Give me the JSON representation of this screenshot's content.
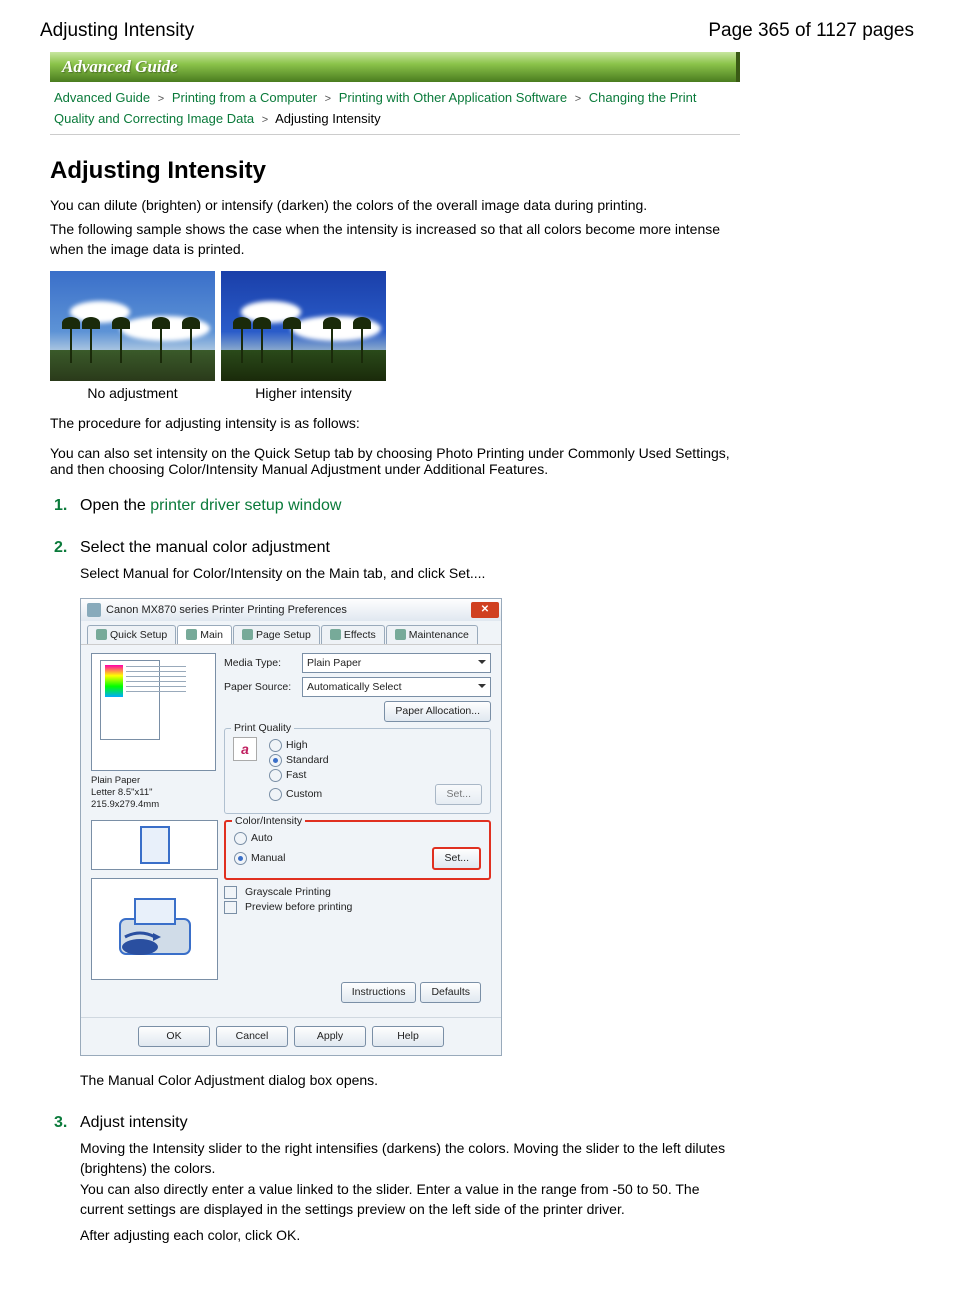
{
  "header": {
    "title_left": "Adjusting Intensity",
    "page_indicator": "Page 365 of 1127 pages"
  },
  "banner": {
    "title": "Advanced Guide"
  },
  "breadcrumb": {
    "links": [
      "Advanced Guide",
      "Printing from a Computer",
      "Printing with Other Application Software",
      "Changing the Print Quality and Correcting Image Data"
    ],
    "current": "Adjusting Intensity",
    "sep": ">"
  },
  "page_title": "Adjusting Intensity",
  "intro1": "You can dilute (brighten) or intensify (darken) the colors of the overall image data during printing.",
  "intro2": "The following sample shows the case when the intensity is increased so that all colors become more intense when the image data is printed.",
  "captions": {
    "left": "No adjustment",
    "right": "Higher intensity"
  },
  "para_proc": "The procedure for adjusting intensity is as follows:",
  "para_quick": "You can also set intensity on the Quick Setup tab by choosing Photo Printing under Commonly Used Settings, and then choosing Color/Intensity Manual Adjustment under Additional Features.",
  "steps": {
    "s1": {
      "num": "1.",
      "title_pre": "Open the ",
      "title_link": "printer driver setup window"
    },
    "s2": {
      "num": "2.",
      "title": "Select the manual color adjustment",
      "body": "Select Manual for Color/Intensity on the Main tab, and click Set....",
      "after": "The Manual Color Adjustment dialog box opens."
    },
    "s3": {
      "num": "3.",
      "title": "Adjust intensity",
      "body1": "Moving the Intensity slider to the right intensifies (darkens) the colors. Moving the slider to the left dilutes (brightens) the colors.",
      "body2": "You can also directly enter a value linked to the slider. Enter a value in the range from -50 to 50. The current settings are displayed in the settings preview on the left side of the printer driver.",
      "body3": "After adjusting each color, click OK."
    }
  },
  "dialog": {
    "title": "Canon MX870 series Printer Printing Preferences",
    "tabs": [
      "Quick Setup",
      "Main",
      "Page Setup",
      "Effects",
      "Maintenance"
    ],
    "active_tab": 1,
    "media_type_label": "Media Type:",
    "media_type_value": "Plain Paper",
    "paper_source_label": "Paper Source:",
    "paper_source_value": "Automatically Select",
    "paper_alloc_btn": "Paper Allocation...",
    "print_quality_label": "Print Quality",
    "pq_options": {
      "high": "High",
      "standard": "Standard",
      "fast": "Fast",
      "custom": "Custom"
    },
    "pq_selected": "standard",
    "pq_set_btn": "Set...",
    "color_intensity_label": "Color/Intensity",
    "ci_options": {
      "auto": "Auto",
      "manual": "Manual"
    },
    "ci_selected": "manual",
    "ci_set_btn": "Set...",
    "grayscale_label": "Grayscale Printing",
    "preview_label": "Preview before printing",
    "left_info1": "Plain Paper",
    "left_info2": "Letter 8.5\"x11\" 215.9x279.4mm",
    "instructions_btn": "Instructions",
    "defaults_btn": "Defaults",
    "ok_btn": "OK",
    "cancel_btn": "Cancel",
    "apply_btn": "Apply",
    "help_btn": "Help"
  }
}
